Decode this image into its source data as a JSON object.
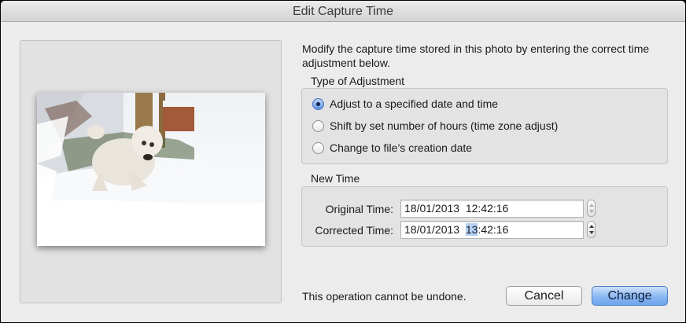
{
  "window": {
    "title": "Edit Capture Time"
  },
  "preview": {
    "icon": "dog-in-snow-photo"
  },
  "intro_text": "Modify the capture time stored in this photo by entering the correct time adjustment below.",
  "adjustment": {
    "label": "Type of Adjustment",
    "options": [
      {
        "label": "Adjust to a specified date and time",
        "checked": true
      },
      {
        "label": "Shift by set number of hours (time zone adjust)",
        "checked": false
      },
      {
        "label": "Change to file’s creation date",
        "checked": false
      }
    ]
  },
  "new_time": {
    "label": "New Time",
    "original_label": "Original Time:",
    "original_value": "18/01/2013  12:42:16",
    "corrected_label": "Corrected Time:",
    "corrected_date": "18/01/2013  ",
    "corrected_hour": "13",
    "corrected_rest": ":42:16"
  },
  "footer": {
    "warning": "This operation cannot be undone.",
    "cancel_label": "Cancel",
    "change_label": "Change"
  },
  "colors": {
    "accent": "#6fa4ec",
    "window_bg": "#ececec",
    "selection": "#b3d1f6"
  }
}
